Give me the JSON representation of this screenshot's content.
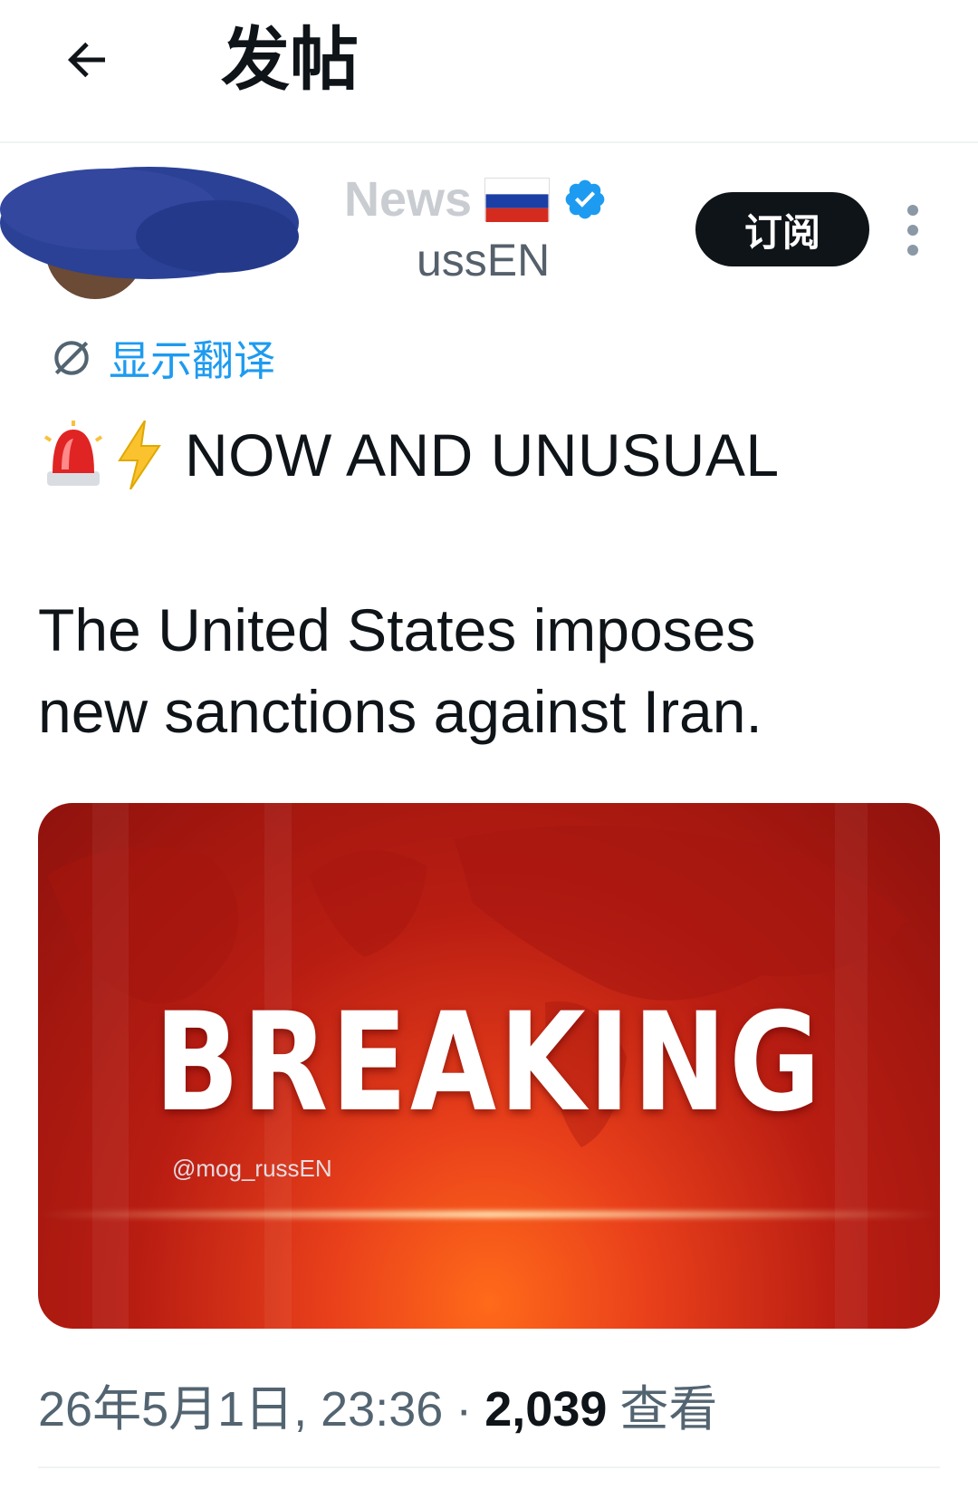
{
  "header": {
    "title": "发帖"
  },
  "author": {
    "display_name_partial": "News",
    "handle_partial": "ussEN",
    "subscribe_label": "订阅"
  },
  "translate": {
    "label": "显示翻译"
  },
  "tweet": {
    "alert_line": "NOW AND UNUSUAL",
    "body": "The United States imposes\nnew sanctions against Iran.",
    "media": {
      "headline": "BREAKING",
      "watermark": "@mog_russEN"
    }
  },
  "meta": {
    "datetime": "26年5月1日, 23:36",
    "separator": "·",
    "views_count": "2,039",
    "views_label": "查看"
  },
  "icons": {
    "back": "arrow-left-icon",
    "verified": "verified-badge-icon",
    "flag": "russia-flag-icon",
    "more": "more-vertical-icon",
    "translate": "translate-icon",
    "siren": "police-light-emoji",
    "lightning": "lightning-emoji"
  },
  "colors": {
    "accent": "#1d9bf0",
    "text": "#0f1419",
    "muted": "#536471",
    "breaking_red": "#c8261a"
  }
}
